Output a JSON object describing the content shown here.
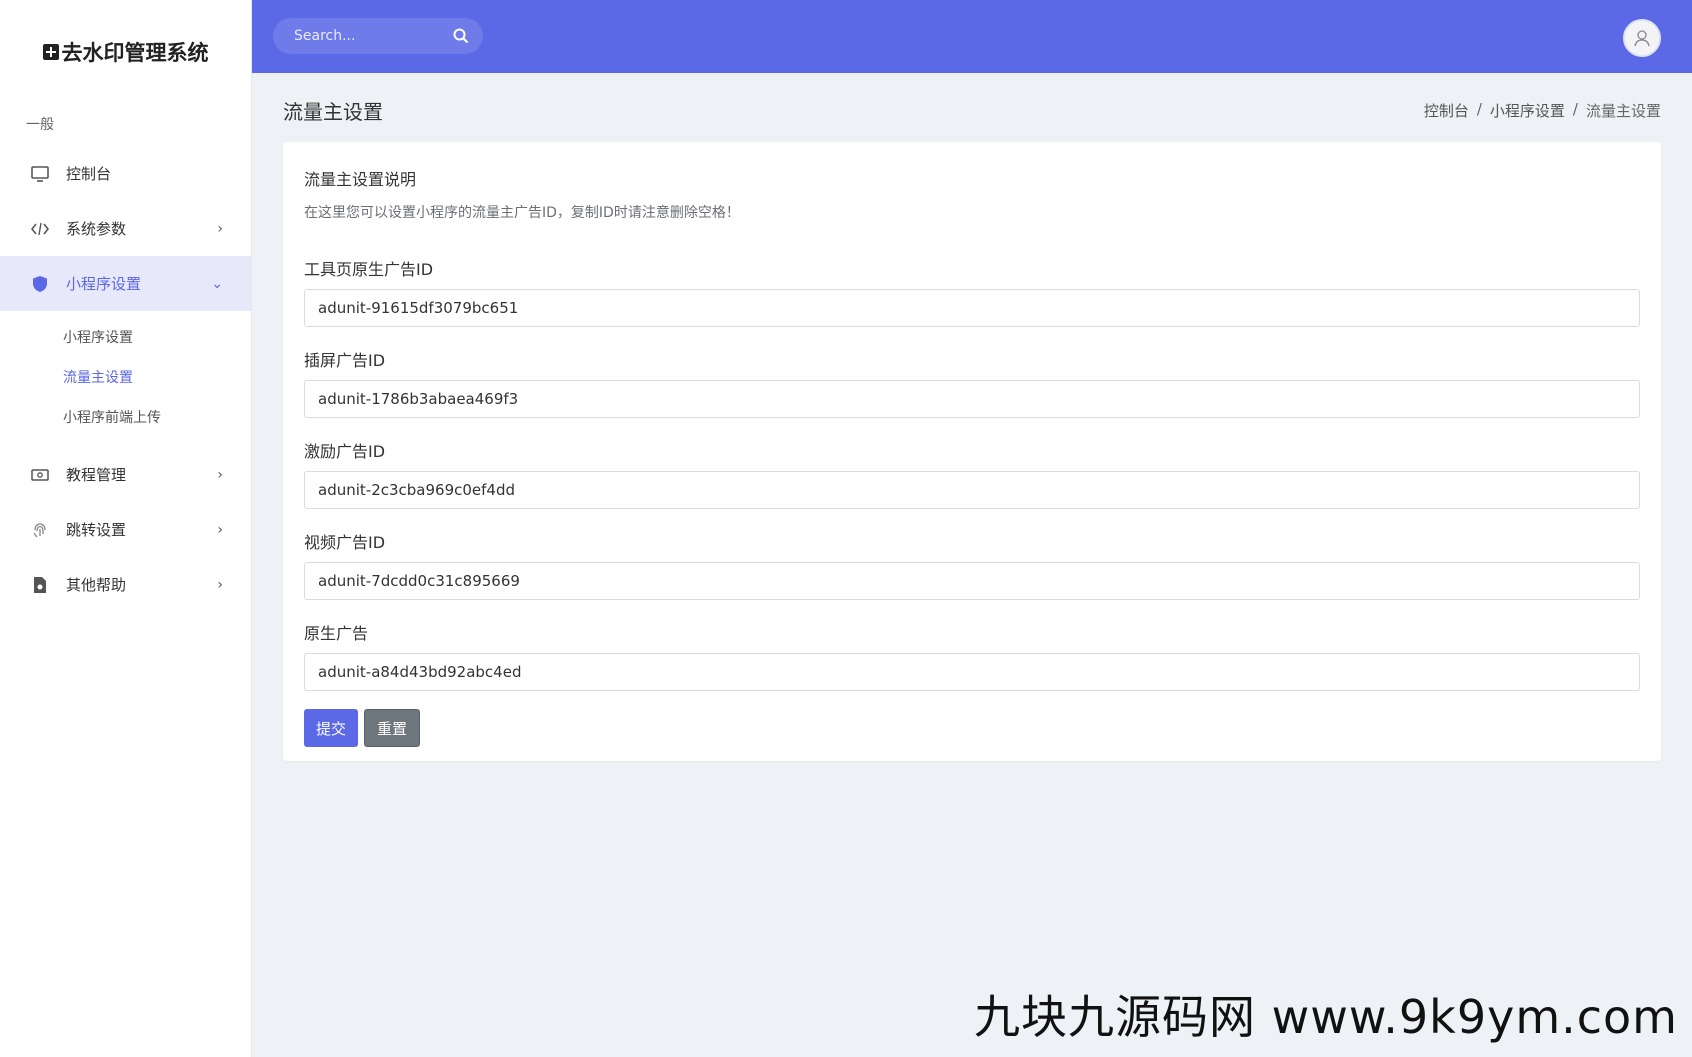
{
  "brand": {
    "title": "去水印管理系统"
  },
  "sidebar": {
    "section": "一般",
    "items": [
      {
        "label": "控制台",
        "icon": "monitor-icon",
        "has_children": false
      },
      {
        "label": "系统参数",
        "icon": "code-icon",
        "has_children": true
      },
      {
        "label": "小程序设置",
        "icon": "shield-icon",
        "has_children": true,
        "active": true
      },
      {
        "label": "教程管理",
        "icon": "money-icon",
        "has_children": true
      },
      {
        "label": "跳转设置",
        "icon": "fingerprint-icon",
        "has_children": true
      },
      {
        "label": "其他帮助",
        "icon": "file-icon",
        "has_children": true
      }
    ],
    "sub_items": [
      {
        "label": "小程序设置"
      },
      {
        "label": "流量主设置",
        "current": true
      },
      {
        "label": "小程序前端上传"
      }
    ]
  },
  "topbar": {
    "search_placeholder": "Search..."
  },
  "page": {
    "title": "流量主设置",
    "breadcrumb": [
      "控制台",
      "小程序设置",
      "流量主设置"
    ],
    "separator": "/"
  },
  "card": {
    "title": "流量主设置说明",
    "desc": "在这里您可以设置小程序的流量主广告ID，复制ID时请注意删除空格！",
    "fields": [
      {
        "label": "工具页原生广告ID",
        "value": "adunit-91615df3079bc651"
      },
      {
        "label": "插屏广告ID",
        "value": "adunit-1786b3abaea469f3"
      },
      {
        "label": "激励广告ID",
        "value": "adunit-2c3cba969c0ef4dd"
      },
      {
        "label": "视频广告ID",
        "value": "adunit-7dcdd0c31c895669"
      },
      {
        "label": "原生广告",
        "value": "adunit-a84d43bd92abc4ed"
      }
    ],
    "submit_label": "提交",
    "reset_label": "重置"
  },
  "watermark": "九块九源码网 www.9k9ym.com",
  "colors": {
    "primary": "#5c69e6",
    "secondary": "#6d757d"
  }
}
